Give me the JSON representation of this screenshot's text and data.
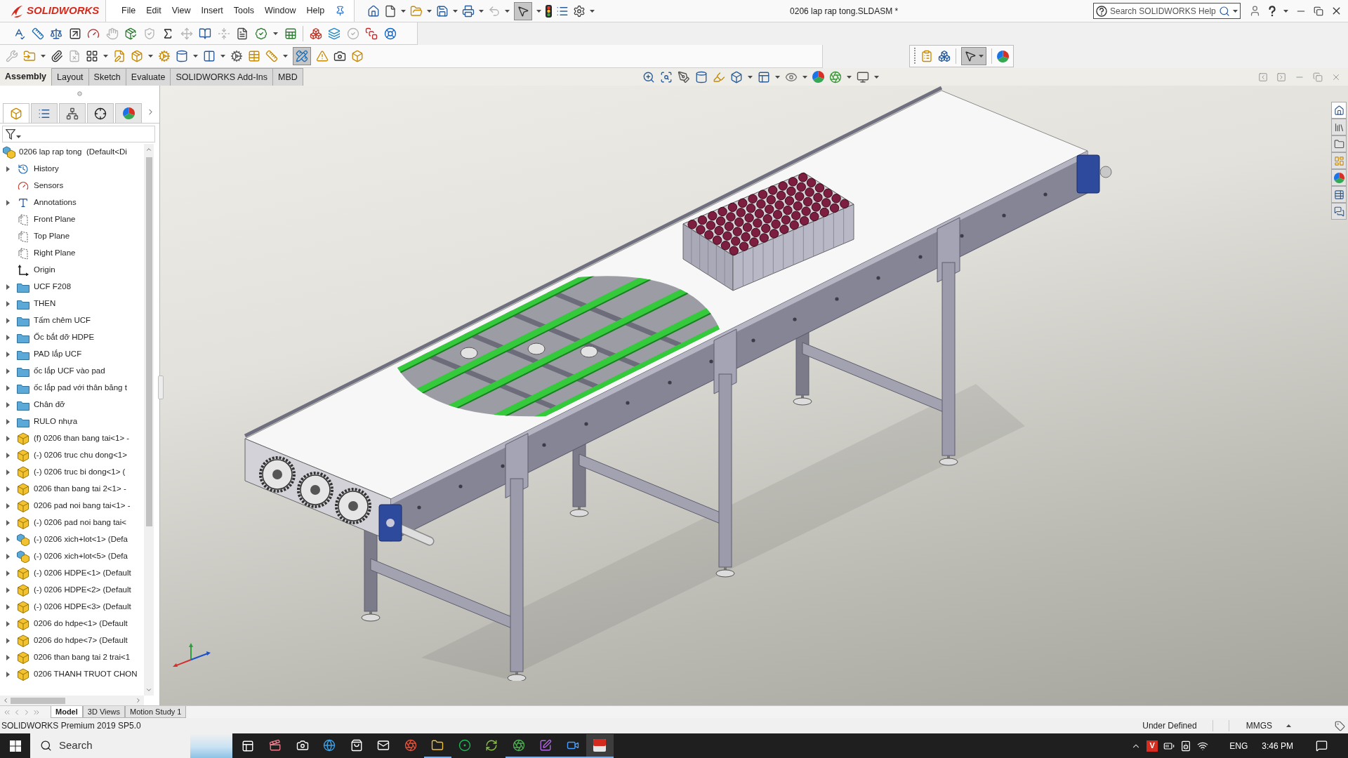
{
  "brand": {
    "name": "SOLIDWORKS"
  },
  "menu": [
    "File",
    "Edit",
    "View",
    "Insert",
    "Tools",
    "Window",
    "Help"
  ],
  "window": {
    "title": "0206 lap rap tong.SLDASM *"
  },
  "help_search": {
    "placeholder": "Search SOLIDWORKS Help"
  },
  "quick_access": {
    "select_tool": {
      "selected": true
    }
  },
  "command_manager": {
    "toggle_tool": {
      "selected": true
    }
  },
  "selection_toolbar": {
    "select_tool": {
      "selected": true
    }
  },
  "command_tabs": [
    {
      "label": "Assembly",
      "selected": true
    },
    {
      "label": "Layout",
      "selected": false
    },
    {
      "label": "Sketch",
      "selected": false
    },
    {
      "label": "Evaluate",
      "selected": false
    },
    {
      "label": "SOLIDWORKS Add-Ins",
      "selected": false
    },
    {
      "label": "MBD",
      "selected": false
    }
  ],
  "manager_tabs": [
    {
      "selected": true
    },
    {
      "selected": false
    },
    {
      "selected": false
    },
    {
      "selected": false
    },
    {
      "selected": false
    }
  ],
  "tree": {
    "root": {
      "label": "0206 lap rap tong  (Default<Di",
      "kind": "assembly"
    },
    "items": [
      {
        "label": "History",
        "kind": "history",
        "expandable": true
      },
      {
        "label": "Sensors",
        "kind": "sensors",
        "expandable": false
      },
      {
        "label": "Annotations",
        "kind": "annotations",
        "expandable": true
      },
      {
        "label": "Front Plane",
        "kind": "plane",
        "expandable": false
      },
      {
        "label": "Top Plane",
        "kind": "plane",
        "expandable": false
      },
      {
        "label": "Right Plane",
        "kind": "plane",
        "expandable": false
      },
      {
        "label": "Origin",
        "kind": "origin",
        "expandable": false
      },
      {
        "label": "UCF F208",
        "kind": "folder",
        "expandable": true
      },
      {
        "label": "THEN",
        "kind": "folder",
        "expandable": true
      },
      {
        "label": "Tấm chêm UCF",
        "kind": "folder",
        "expandable": true
      },
      {
        "label": "Ốc bắt dỡ HDPE",
        "kind": "folder",
        "expandable": true
      },
      {
        "label": "PAD lắp UCF",
        "kind": "folder",
        "expandable": true
      },
      {
        "label": "ốc lắp UCF vào pad",
        "kind": "folder",
        "expandable": true
      },
      {
        "label": "ốc lắp pad với thân băng t",
        "kind": "folder",
        "expandable": true
      },
      {
        "label": "Chân đỡ",
        "kind": "folder",
        "expandable": true
      },
      {
        "label": "RULO nhựa",
        "kind": "folder",
        "expandable": true
      },
      {
        "label": "(f) 0206 than bang tai<1> -",
        "kind": "part",
        "expandable": true
      },
      {
        "label": "(-) 0206 truc chu dong<1>",
        "kind": "part",
        "expandable": true
      },
      {
        "label": "(-) 0206 truc bi dong<1> (",
        "kind": "part",
        "expandable": true
      },
      {
        "label": "0206 than bang tai 2<1> -",
        "kind": "part",
        "expandable": true
      },
      {
        "label": "0206 pad noi bang tai<1> -",
        "kind": "part",
        "expandable": true
      },
      {
        "label": "(-) 0206 pad noi bang tai<",
        "kind": "part",
        "expandable": true
      },
      {
        "label": "(-) 0206 xich+lot<1> (Defa",
        "kind": "assembly",
        "expandable": true
      },
      {
        "label": "(-) 0206 xich+lot<5> (Defa",
        "kind": "assembly",
        "expandable": true
      },
      {
        "label": "(-) 0206 HDPE<1> (Default",
        "kind": "part",
        "expandable": true
      },
      {
        "label": "(-) 0206 HDPE<2> (Default",
        "kind": "part",
        "expandable": true
      },
      {
        "label": "(-) 0206 HDPE<3> (Default",
        "kind": "part",
        "expandable": true
      },
      {
        "label": "0206 do hdpe<1> (Default",
        "kind": "part",
        "expandable": true
      },
      {
        "label": "0206 do hdpe<7> (Default",
        "kind": "part",
        "expandable": true
      },
      {
        "label": "0206 than bang tai 2 trai<1",
        "kind": "part",
        "expandable": true
      },
      {
        "label": "0206 THANH TRUOT CHON",
        "kind": "part",
        "expandable": true
      }
    ]
  },
  "task_pane_tabs": [
    {
      "selected": true
    },
    {
      "selected": false
    },
    {
      "selected": false
    },
    {
      "selected": false
    },
    {
      "selected": false
    },
    {
      "selected": false
    },
    {
      "selected": false
    }
  ],
  "bottom_tabs": [
    {
      "label": "Model",
      "selected": true
    },
    {
      "label": "3D Views",
      "selected": false
    },
    {
      "label": "Motion Study 1",
      "selected": false
    }
  ],
  "status_bar": {
    "product": "SOLIDWORKS Premium 2019 SP5.0",
    "state": "Under Defined",
    "units": "MMGS"
  },
  "taskbar": {
    "search": {
      "placeholder": "Search"
    },
    "apps": [
      {
        "running": false,
        "selected": false
      },
      {
        "running": false,
        "selected": false
      },
      {
        "running": false,
        "selected": false
      },
      {
        "running": false,
        "selected": false
      },
      {
        "running": false,
        "selected": false
      },
      {
        "running": false,
        "selected": false
      },
      {
        "running": true,
        "selected": false
      },
      {
        "running": false,
        "selected": false
      },
      {
        "running": false,
        "selected": false
      },
      {
        "running": true,
        "selected": false
      },
      {
        "running": true,
        "selected": false
      },
      {
        "running": true,
        "selected": false
      },
      {
        "running": true,
        "selected": true
      }
    ],
    "ime": "V",
    "language": "ENG",
    "time": "3:46 PM"
  }
}
